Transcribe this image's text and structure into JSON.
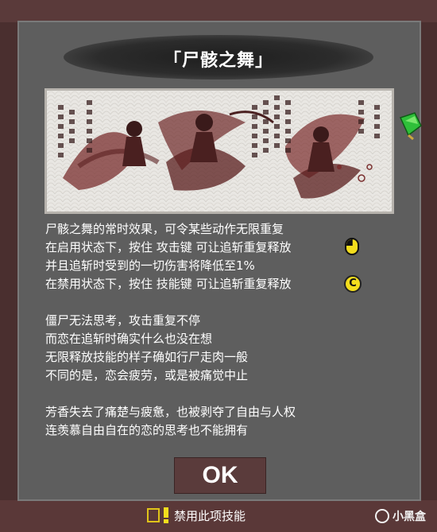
{
  "dialog": {
    "title": "「尸骸之舞」",
    "artwork_icon": "corpse-dance-illustration",
    "description_lines": [
      "尸骸之舞的常时效果，可令某些动作无限重复",
      "在启用状态下，按住 攻击键 可让追斩重复释放",
      "并且追斩时受到的一切伤害将降低至1%",
      "在禁用状态下，按住 技能键 可让追斩重复释放",
      "",
      "僵尸无法思考，攻击重复不停",
      "而恋在追斩时确实什么也没在想",
      "无限释放技能的样子确如行尸走肉一般",
      "不同的是，恋会疲劳，或是被痛觉中止",
      "",
      "芳香失去了痛楚与疲惫，也被剥夺了自由与人权",
      "连羡慕自由自在的恋的思考也不能拥有"
    ],
    "attack_key_icon": "mouse-left-click-icon",
    "skill_key_icon": {
      "name": "c-key-icon",
      "label": "C"
    },
    "ok_label": "OK",
    "disable_label": "禁用此项技能"
  },
  "watermark": {
    "text": "小黑盒",
    "icon": "xiaoheihe-logo"
  },
  "colors": {
    "panel": "#5e5e5e",
    "button": "#5a3b3b",
    "accent_yellow": "#f3dd1d",
    "frame_border": "#4a2f2f"
  }
}
